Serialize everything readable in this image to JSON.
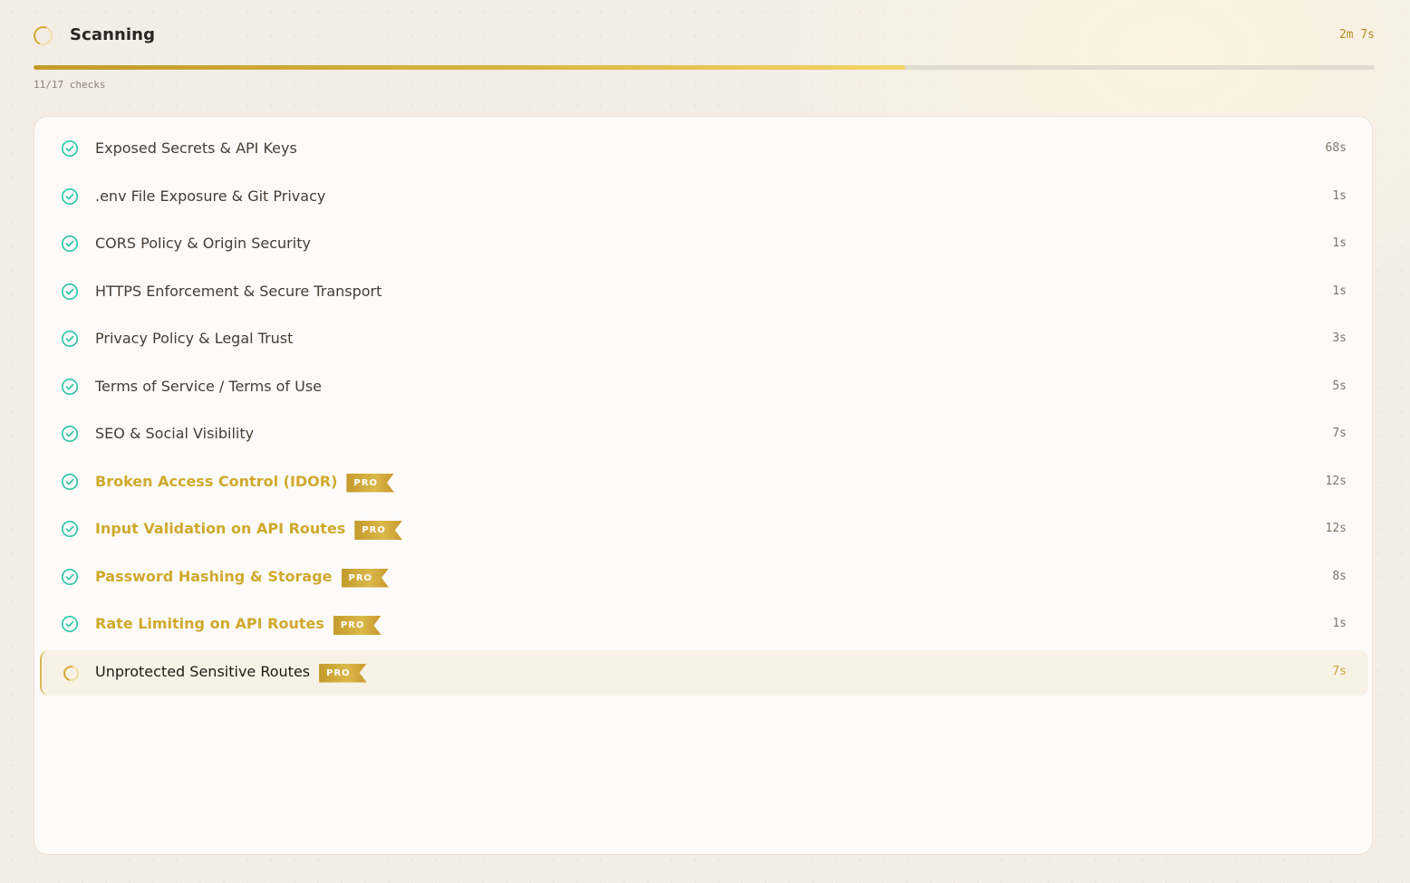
{
  "header": {
    "title": "Scanning",
    "elapsed": "2m 7s",
    "progress_fraction": 0.65,
    "checks_label": "11/17 checks"
  },
  "colors": {
    "accent_gold": "#d0a92c",
    "success_teal": "#2dc6a8",
    "badge_gold": "#c49a2c"
  },
  "icons": {
    "done": "check-circle-icon",
    "running": "loading-spinner-icon"
  },
  "badge_label": "PRO",
  "checks": [
    {
      "label": "Exposed Secrets & API Keys",
      "time": "68s",
      "status": "done",
      "pro": false
    },
    {
      "label": ".env File Exposure & Git Privacy",
      "time": "1s",
      "status": "done",
      "pro": false
    },
    {
      "label": "CORS Policy & Origin Security",
      "time": "1s",
      "status": "done",
      "pro": false
    },
    {
      "label": "HTTPS Enforcement & Secure Transport",
      "time": "1s",
      "status": "done",
      "pro": false
    },
    {
      "label": "Privacy Policy & Legal Trust",
      "time": "3s",
      "status": "done",
      "pro": false
    },
    {
      "label": "Terms of Service / Terms of Use",
      "time": "5s",
      "status": "done",
      "pro": false
    },
    {
      "label": "SEO & Social Visibility",
      "time": "7s",
      "status": "done",
      "pro": false
    },
    {
      "label": "Broken Access Control (IDOR)",
      "time": "12s",
      "status": "done",
      "pro": true
    },
    {
      "label": "Input Validation on API Routes",
      "time": "12s",
      "status": "done",
      "pro": true
    },
    {
      "label": "Password Hashing & Storage",
      "time": "8s",
      "status": "done",
      "pro": true
    },
    {
      "label": "Rate Limiting on API Routes",
      "time": "1s",
      "status": "done",
      "pro": true
    },
    {
      "label": "Unprotected Sensitive Routes",
      "time": "7s",
      "status": "running",
      "pro": true
    }
  ]
}
